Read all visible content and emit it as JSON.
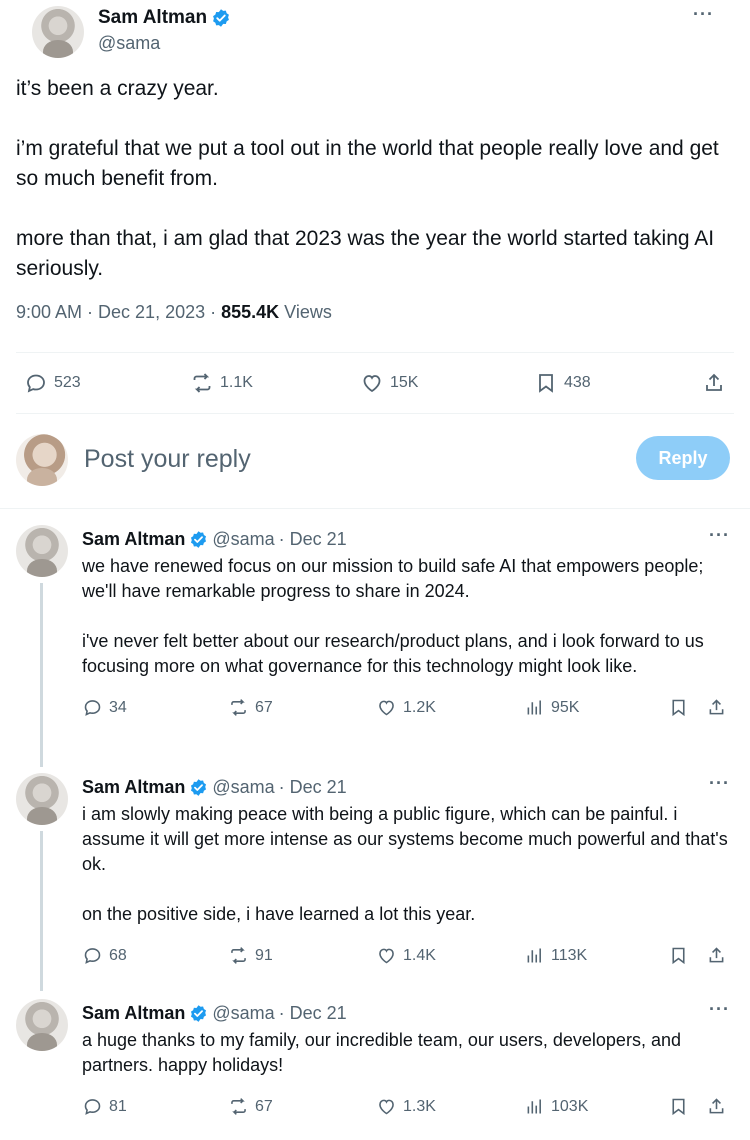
{
  "main_tweet": {
    "author_name": "Sam Altman",
    "handle": "@sama",
    "more": "···",
    "text": "it’s been a crazy year.\n\ni’m grateful that we put a tool out in the world that people really love and get so much benefit from.\n\nmore than that, i am glad that 2023 was the year the world started taking AI seriously.",
    "time": "9:00 AM · Dec 21, 2023 · ",
    "views_count": "855.4K",
    "views_label": " Views",
    "actions": {
      "replies": "523",
      "reposts": "1.1K",
      "likes": "15K",
      "bookmarks": "438"
    }
  },
  "reply_box": {
    "placeholder": "Post your reply",
    "button": "Reply"
  },
  "thread": [
    {
      "author_name": "Sam Altman",
      "handle": "@sama",
      "date": "· Dec 21",
      "text": "we have renewed focus on our mission to build safe AI that empowers people; we'll have remarkable progress to share in 2024.\n\ni've never felt better about our research/product plans, and i look forward to us focusing more on what governance for this technology might look like.",
      "replies": "34",
      "reposts": "67",
      "likes": "1.2K",
      "views": "95K"
    },
    {
      "author_name": "Sam Altman",
      "handle": "@sama",
      "date": "· Dec 21",
      "text": "i am slowly making peace with being a public figure, which can be painful. i assume it will get more intense as our systems become much powerful and that's ok.\n\non the positive side, i have learned a lot this year.",
      "replies": "68",
      "reposts": "91",
      "likes": "1.4K",
      "views": "113K"
    },
    {
      "author_name": "Sam Altman",
      "handle": "@sama",
      "date": "· Dec 21",
      "text": "a huge thanks to my family, our incredible team, our users, developers, and partners. happy holidays!",
      "replies": "81",
      "reposts": "67",
      "likes": "1.3K",
      "views": "103K"
    }
  ],
  "colors": {
    "text": "#0f1419",
    "secondary": "#536471",
    "verified": "#1d9bf0",
    "reply_button": "#8ecdf8",
    "thread_line": "#cfd9de"
  },
  "icons": [
    "verified-badge-icon",
    "reply-icon",
    "repost-icon",
    "like-icon",
    "bookmark-icon",
    "share-icon",
    "views-icon",
    "more-icon"
  ]
}
